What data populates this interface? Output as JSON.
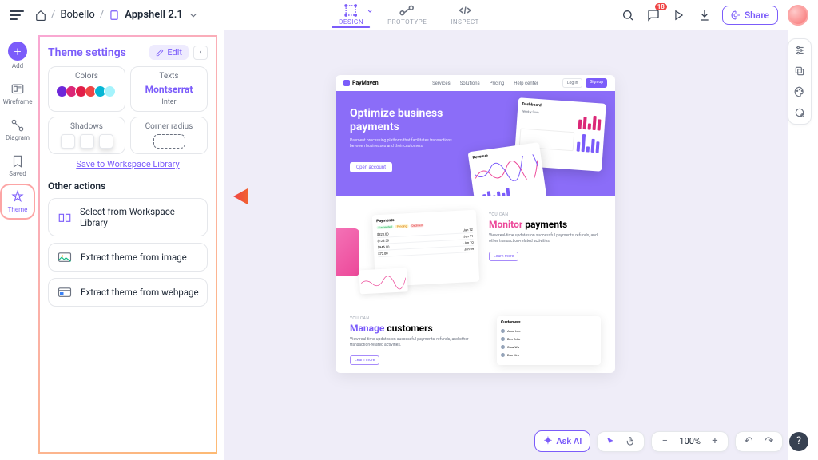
{
  "breadcrumb": {
    "workspace": "Bobello",
    "file": "Appshell 2.1"
  },
  "modes": {
    "design": "DESIGN",
    "prototype": "PROTOTYPE",
    "inspect": "INSPECT"
  },
  "top": {
    "notif_count": "18",
    "share": "Share"
  },
  "rail": {
    "add": "Add",
    "wireframe": "Wireframe",
    "diagram": "Diagram",
    "saved": "Saved",
    "theme": "Theme"
  },
  "theme_panel": {
    "title": "Theme settings",
    "edit": "Edit",
    "colors_label": "Colors",
    "texts_label": "Texts",
    "font_primary": "Montserrat",
    "font_secondary": "Inter",
    "shadows_label": "Shadows",
    "corner_label": "Corner radius",
    "save_link": "Save to Workspace Library",
    "swatch_colors": [
      "#6D28D9",
      "#DB2777",
      "#E11D48",
      "#EF4444",
      "#06B6D4",
      "#22D3EE"
    ]
  },
  "other_actions": {
    "title": "Other actions",
    "a1": "Select from Workspace Library",
    "a2": "Extract theme from image",
    "a3": "Extract theme from webpage"
  },
  "artboard": {
    "product": "PayMaven",
    "nav": {
      "n1": "Services",
      "n2": "Solutions",
      "n3": "Pricing",
      "n4": "Help center"
    },
    "login": "Log in",
    "signup": "Sign up",
    "hero_title": "Optimize business payments",
    "hero_body": "Payment processing platform that facilitates transactions between businesses and their customers.",
    "hero_cta": "Open account",
    "mock1_title": "Dashboard",
    "mock2_title": "Payments",
    "kicker": "YOU CAN",
    "monitor_h": "Monitor",
    "monitor_h2": "payments",
    "monitor_body": "View real-time updates on successful payments, refunds, and other transaction-related activities.",
    "learn": "Learn more",
    "manage_h": "Manage",
    "manage_h2": "customers",
    "manage_body": "View real-time updates on successful payments, refunds, and other transaction-related activities.",
    "cust_title": "Customers"
  },
  "bottom": {
    "askai": "Ask AI",
    "zoom": "100%"
  }
}
